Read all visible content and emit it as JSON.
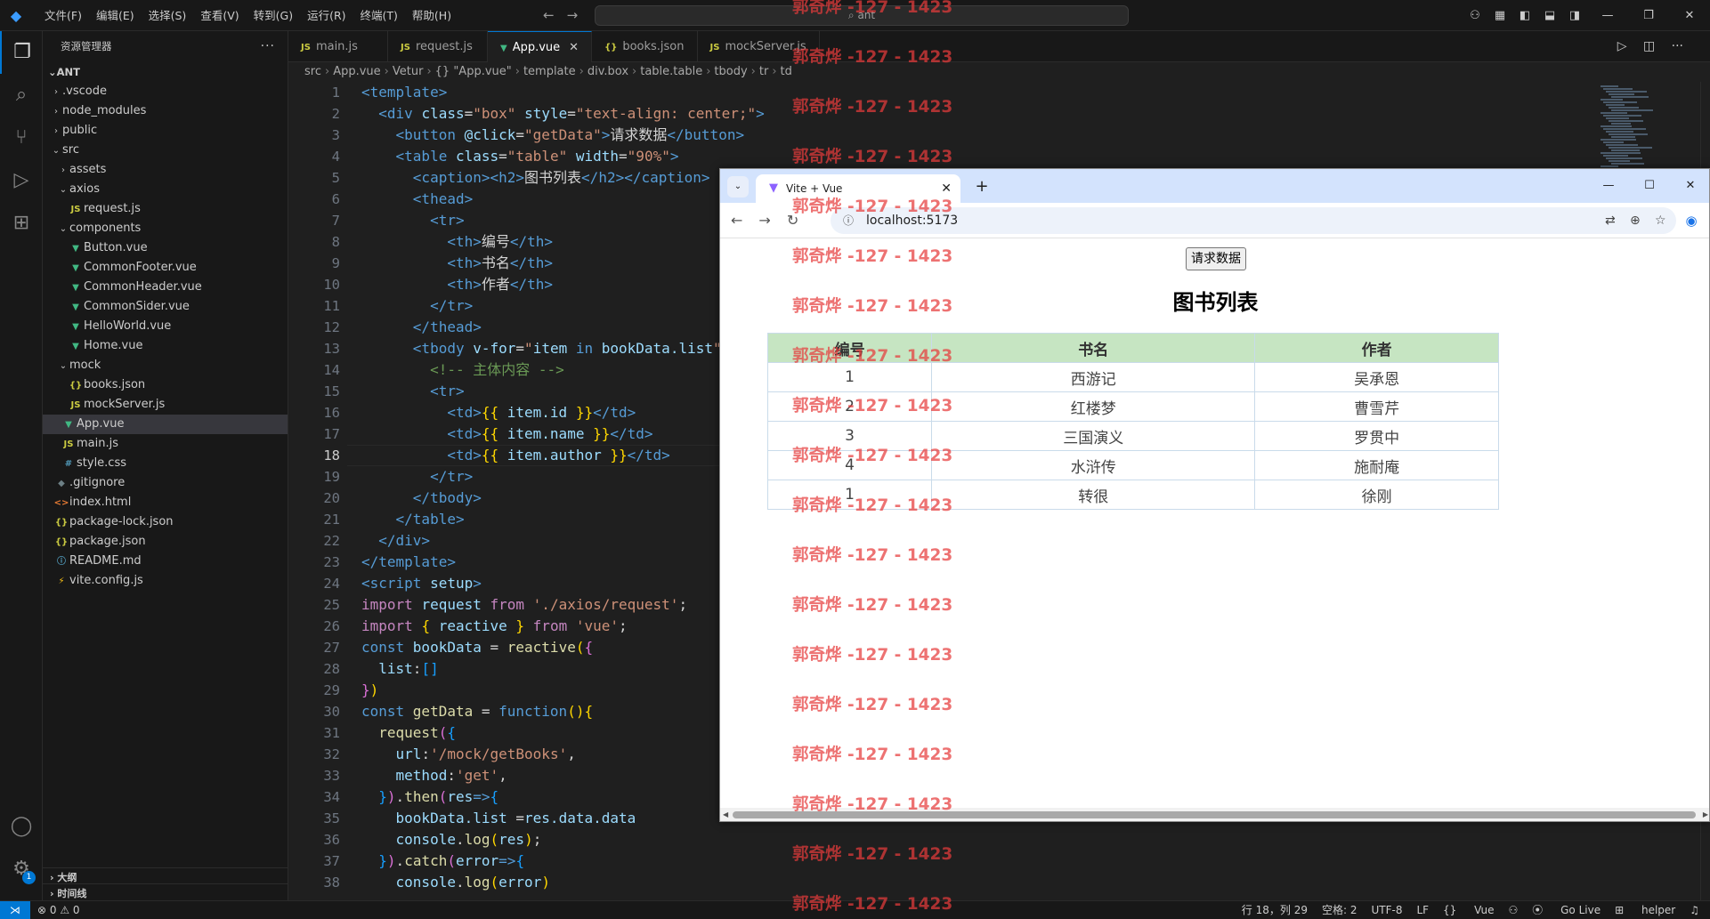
{
  "titlebar": {
    "menus": [
      "文件(F)",
      "编辑(E)",
      "选择(S)",
      "查看(V)",
      "转到(G)",
      "运行(R)",
      "终端(T)",
      "帮助(H)"
    ],
    "search_text": "ant"
  },
  "sidebar": {
    "title": "资源管理器",
    "root": "ANT",
    "items": [
      {
        "label": ".vscode",
        "type": "folder",
        "expanded": false,
        "depth": 1
      },
      {
        "label": "node_modules",
        "type": "folder",
        "expanded": false,
        "depth": 1
      },
      {
        "label": "public",
        "type": "folder",
        "expanded": false,
        "depth": 1
      },
      {
        "label": "src",
        "type": "folder",
        "expanded": true,
        "depth": 1
      },
      {
        "label": "assets",
        "type": "folder",
        "expanded": false,
        "depth": 2
      },
      {
        "label": "axios",
        "type": "folder",
        "expanded": true,
        "depth": 2
      },
      {
        "label": "request.js",
        "type": "js",
        "depth": 3
      },
      {
        "label": "components",
        "type": "folder",
        "expanded": true,
        "depth": 2
      },
      {
        "label": "Button.vue",
        "type": "vue",
        "depth": 3
      },
      {
        "label": "CommonFooter.vue",
        "type": "vue",
        "depth": 3
      },
      {
        "label": "CommonHeader.vue",
        "type": "vue",
        "depth": 3
      },
      {
        "label": "CommonSider.vue",
        "type": "vue",
        "depth": 3
      },
      {
        "label": "HelloWorld.vue",
        "type": "vue",
        "depth": 3
      },
      {
        "label": "Home.vue",
        "type": "vue",
        "depth": 3
      },
      {
        "label": "mock",
        "type": "folder",
        "expanded": true,
        "depth": 2
      },
      {
        "label": "books.json",
        "type": "json",
        "depth": 3
      },
      {
        "label": "mockServer.js",
        "type": "js",
        "depth": 3
      },
      {
        "label": "App.vue",
        "type": "vue",
        "depth": 2,
        "active": true
      },
      {
        "label": "main.js",
        "type": "js",
        "depth": 2
      },
      {
        "label": "style.css",
        "type": "css",
        "depth": 2
      },
      {
        "label": ".gitignore",
        "type": "git",
        "depth": 1
      },
      {
        "label": "index.html",
        "type": "html",
        "depth": 1
      },
      {
        "label": "package-lock.json",
        "type": "json",
        "depth": 1
      },
      {
        "label": "package.json",
        "type": "json",
        "depth": 1
      },
      {
        "label": "README.md",
        "type": "info",
        "depth": 1
      },
      {
        "label": "vite.config.js",
        "type": "vite",
        "depth": 1
      }
    ],
    "outline_label": "大纲",
    "timeline_label": "时间线"
  },
  "tabs": [
    {
      "label": "main.js",
      "type": "js",
      "active": false
    },
    {
      "label": "request.js",
      "type": "js",
      "active": false
    },
    {
      "label": "App.vue",
      "type": "vue",
      "active": true
    },
    {
      "label": "books.json",
      "type": "json",
      "active": false
    },
    {
      "label": "mockServer.js",
      "type": "js",
      "active": false
    }
  ],
  "breadcrumb": [
    "src",
    "App.vue",
    "Vetur",
    "{} \"App.vue\"",
    "template",
    "div.box",
    "table.table",
    "tbody",
    "tr",
    "td"
  ],
  "editor": {
    "current_line": 18,
    "line_numbers": [
      "1",
      "2",
      "3",
      "4",
      "5",
      "6",
      "7",
      "8",
      "9",
      "10",
      "11",
      "12",
      "13",
      "14",
      "15",
      "16",
      "17",
      "18",
      "19",
      "20",
      "21",
      "22",
      "23",
      "24",
      "25",
      "26",
      "27",
      "28",
      "29",
      "30",
      "31",
      "32",
      "33",
      "34",
      "35",
      "36",
      "37",
      "38"
    ],
    "lines": [
      [
        [
          "t-tag",
          "<template>"
        ]
      ],
      [
        [
          "t-txt",
          "  "
        ],
        [
          "t-tag",
          "<div "
        ],
        [
          "t-attr",
          "class"
        ],
        [
          "t-txt",
          "="
        ],
        [
          "t-str",
          "\"box\""
        ],
        [
          "t-txt",
          " "
        ],
        [
          "t-attr",
          "style"
        ],
        [
          "t-txt",
          "="
        ],
        [
          "t-str",
          "\"text-align: center;\""
        ],
        [
          "t-tag",
          ">"
        ]
      ],
      [
        [
          "t-txt",
          "    "
        ],
        [
          "t-tag",
          "<button "
        ],
        [
          "t-attr",
          "@click"
        ],
        [
          "t-txt",
          "="
        ],
        [
          "t-str",
          "\"getData\""
        ],
        [
          "t-tag",
          ">"
        ],
        [
          "t-txt",
          "请求数据"
        ],
        [
          "t-tag",
          "</button>"
        ]
      ],
      [
        [
          "t-txt",
          "    "
        ],
        [
          "t-tag",
          "<table "
        ],
        [
          "t-attr",
          "class"
        ],
        [
          "t-txt",
          "="
        ],
        [
          "t-str",
          "\"table\""
        ],
        [
          "t-txt",
          " "
        ],
        [
          "t-attr",
          "width"
        ],
        [
          "t-txt",
          "="
        ],
        [
          "t-str",
          "\"90%\""
        ],
        [
          "t-tag",
          ">"
        ]
      ],
      [
        [
          "t-txt",
          "      "
        ],
        [
          "t-tag",
          "<caption><h2>"
        ],
        [
          "t-txt",
          "图书列表"
        ],
        [
          "t-tag",
          "</h2></caption>"
        ]
      ],
      [
        [
          "t-txt",
          "      "
        ],
        [
          "t-tag",
          "<thead>"
        ]
      ],
      [
        [
          "t-txt",
          "        "
        ],
        [
          "t-tag",
          "<tr>"
        ]
      ],
      [
        [
          "t-txt",
          "          "
        ],
        [
          "t-tag",
          "<th>"
        ],
        [
          "t-txt",
          "编号"
        ],
        [
          "t-tag",
          "</th>"
        ]
      ],
      [
        [
          "t-txt",
          "          "
        ],
        [
          "t-tag",
          "<th>"
        ],
        [
          "t-txt",
          "书名"
        ],
        [
          "t-tag",
          "</th>"
        ]
      ],
      [
        [
          "t-txt",
          "          "
        ],
        [
          "t-tag",
          "<th>"
        ],
        [
          "t-txt",
          "作者"
        ],
        [
          "t-tag",
          "</th>"
        ]
      ],
      [
        [
          "t-txt",
          "        "
        ],
        [
          "t-tag",
          "</tr>"
        ]
      ],
      [
        [
          "t-txt",
          "      "
        ],
        [
          "t-tag",
          "</thead>"
        ]
      ],
      [
        [
          "t-txt",
          "      "
        ],
        [
          "t-tag",
          "<tbody "
        ],
        [
          "t-attr",
          "v-for"
        ],
        [
          "t-txt",
          "="
        ],
        [
          "t-str",
          "\""
        ],
        [
          "t-var",
          "item"
        ],
        [
          "t-kw2",
          " in "
        ],
        [
          "t-var",
          "bookData.list"
        ],
        [
          "t-str",
          "\""
        ],
        [
          "t-tag",
          ">"
        ]
      ],
      [
        [
          "t-txt",
          "        "
        ],
        [
          "t-cm",
          "<!-- 主体内容 -->"
        ]
      ],
      [
        [
          "t-txt",
          "        "
        ],
        [
          "t-tag",
          "<tr>"
        ]
      ],
      [
        [
          "t-txt",
          "          "
        ],
        [
          "t-tag",
          "<td>"
        ],
        [
          "t-br",
          "{{"
        ],
        [
          "t-var",
          " item.id "
        ],
        [
          "t-br",
          "}}"
        ],
        [
          "t-tag",
          "</td>"
        ]
      ],
      [
        [
          "t-txt",
          "          "
        ],
        [
          "t-tag",
          "<td>"
        ],
        [
          "t-br",
          "{{"
        ],
        [
          "t-var",
          " item.name "
        ],
        [
          "t-br",
          "}}"
        ],
        [
          "t-tag",
          "</td>"
        ]
      ],
      [
        [
          "t-txt",
          "          "
        ],
        [
          "t-tag",
          "<td>"
        ],
        [
          "t-br",
          "{{"
        ],
        [
          "t-var",
          " item.author "
        ],
        [
          "t-br",
          "}}"
        ],
        [
          "t-tag",
          "</td>"
        ]
      ],
      [
        [
          "t-txt",
          "        "
        ],
        [
          "t-tag",
          "</tr>"
        ]
      ],
      [
        [
          "t-txt",
          "      "
        ],
        [
          "t-tag",
          "</tbody>"
        ]
      ],
      [
        [
          "t-txt",
          "    "
        ],
        [
          "t-tag",
          "</table>"
        ]
      ],
      [
        [
          "t-txt",
          "  "
        ],
        [
          "t-tag",
          "</div>"
        ]
      ],
      [
        [
          "t-tag",
          "</template>"
        ]
      ],
      [
        [
          "t-tag",
          "<script "
        ],
        [
          "t-attr",
          "setup"
        ],
        [
          "t-tag",
          ">"
        ]
      ],
      [
        [
          "t-kw",
          "import "
        ],
        [
          "t-var",
          "request "
        ],
        [
          "t-kw",
          "from "
        ],
        [
          "t-str",
          "'./axios/request'"
        ],
        [
          "t-txt",
          ";"
        ]
      ],
      [
        [
          "t-kw",
          "import "
        ],
        [
          "t-br",
          "{ "
        ],
        [
          "t-var",
          "reactive "
        ],
        [
          "t-br",
          "} "
        ],
        [
          "t-kw",
          "from "
        ],
        [
          "t-str",
          "'vue'"
        ],
        [
          "t-txt",
          ";"
        ]
      ],
      [
        [
          "t-kw2",
          "const "
        ],
        [
          "t-var",
          "bookData "
        ],
        [
          "t-txt",
          "= "
        ],
        [
          "t-fn",
          "reactive"
        ],
        [
          "t-br",
          "("
        ],
        [
          "t-br2",
          "{"
        ]
      ],
      [
        [
          "t-txt",
          "  "
        ],
        [
          "t-var",
          "list"
        ],
        [
          "t-txt",
          ":"
        ],
        [
          "t-br3",
          "[]"
        ]
      ],
      [
        [
          "t-br2",
          "}"
        ],
        [
          "t-br",
          ")"
        ]
      ],
      [
        [
          "t-kw2",
          "const "
        ],
        [
          "t-fn",
          "getData "
        ],
        [
          "t-txt",
          "= "
        ],
        [
          "t-kw2",
          "function"
        ],
        [
          "t-br",
          "()"
        ],
        [
          "t-br",
          "{"
        ]
      ],
      [
        [
          "t-txt",
          "  "
        ],
        [
          "t-fn",
          "request"
        ],
        [
          "t-br2",
          "("
        ],
        [
          "t-br3",
          "{"
        ]
      ],
      [
        [
          "t-txt",
          "    "
        ],
        [
          "t-var",
          "url"
        ],
        [
          "t-txt",
          ":"
        ],
        [
          "t-str",
          "'/mock/getBooks'"
        ],
        [
          "t-txt",
          ","
        ]
      ],
      [
        [
          "t-txt",
          "    "
        ],
        [
          "t-var",
          "method"
        ],
        [
          "t-txt",
          ":"
        ],
        [
          "t-str",
          "'get'"
        ],
        [
          "t-txt",
          ","
        ]
      ],
      [
        [
          "t-txt",
          "  "
        ],
        [
          "t-br3",
          "}"
        ],
        [
          "t-br2",
          ")"
        ],
        [
          "t-txt",
          "."
        ],
        [
          "t-fn",
          "then"
        ],
        [
          "t-br2",
          "("
        ],
        [
          "t-var",
          "res"
        ],
        [
          "t-kw2",
          "=>"
        ],
        [
          "t-br3",
          "{"
        ]
      ],
      [
        [
          "t-txt",
          "    "
        ],
        [
          "t-var",
          "bookData.list "
        ],
        [
          "t-txt",
          "="
        ],
        [
          "t-var",
          "res.data.data"
        ]
      ],
      [
        [
          "t-txt",
          "    "
        ],
        [
          "t-var",
          "console"
        ],
        [
          "t-txt",
          "."
        ],
        [
          "t-fn",
          "log"
        ],
        [
          "t-br",
          "("
        ],
        [
          "t-var",
          "res"
        ],
        [
          "t-br",
          ")"
        ],
        [
          "t-txt",
          ";"
        ]
      ],
      [
        [
          "t-txt",
          "  "
        ],
        [
          "t-br3",
          "}"
        ],
        [
          "t-br2",
          ")"
        ],
        [
          "t-txt",
          "."
        ],
        [
          "t-fn",
          "catch"
        ],
        [
          "t-br2",
          "("
        ],
        [
          "t-var",
          "error"
        ],
        [
          "t-kw2",
          "=>"
        ],
        [
          "t-br3",
          "{"
        ]
      ],
      [
        [
          "t-txt",
          "    "
        ],
        [
          "t-var",
          "console"
        ],
        [
          "t-txt",
          "."
        ],
        [
          "t-fn",
          "log"
        ],
        [
          "t-br",
          "("
        ],
        [
          "t-var",
          "error"
        ],
        [
          "t-br",
          ")"
        ]
      ]
    ]
  },
  "statusbar": {
    "problems": "⊗ 0 ⚠ 0",
    "position": "行 18，列 29",
    "spaces": "空格: 2",
    "encoding": "UTF-8",
    "eol": "LF",
    "language": "Vue",
    "golive": "Go Live",
    "helper": "helper"
  },
  "browser": {
    "tab_title": "Vite + Vue",
    "url": "localhost:5173",
    "button_label": "请求数据",
    "caption": "图书列表",
    "headers": [
      "编号",
      "书名",
      "作者"
    ],
    "rows": [
      [
        "1",
        "西游记",
        "吴承恩"
      ],
      [
        "2",
        "红楼梦",
        "曹雪芹"
      ],
      [
        "3",
        "三国演义",
        "罗贯中"
      ],
      [
        "4",
        "水浒传",
        "施耐庵"
      ],
      [
        "1",
        "转很",
        "徐刚"
      ]
    ]
  },
  "watermark": "郭奇烨 -127 - 1423",
  "colors": {
    "accent": "#0078d4",
    "table_header_bg": "#c6e5c2",
    "watermark": "#e63c3c"
  }
}
